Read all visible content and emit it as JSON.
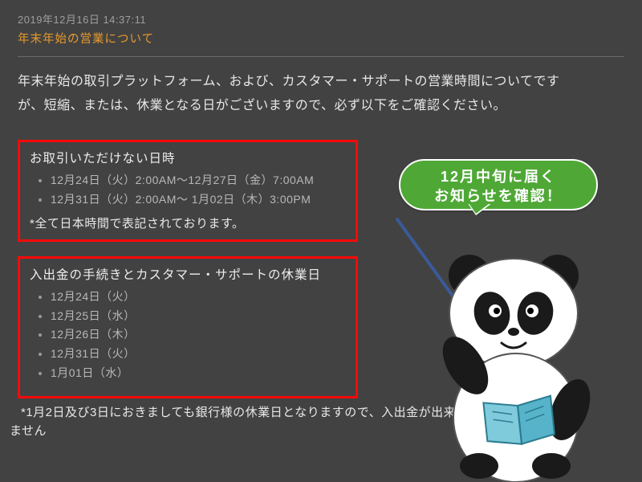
{
  "timestamp": "2019年12月16日 14:37:11",
  "title": "年末年始の営業について",
  "intro": "年末年始の取引プラットフォーム、および、カスタマー・サポートの営業時間についてですが、短縮、または、休業となる日がございますので、必ず以下をご確認ください。",
  "box1": {
    "heading": "お取引いただけない日時",
    "items": [
      "12月24日（火）2:00AM〜12月27日（金）7:00AM",
      "12月31日（火）2:00AM〜  1月02日（木）3:00PM"
    ],
    "note": "*全て日本時間で表記されております。"
  },
  "box2": {
    "heading": "入出金の手続きとカスタマー・サポートの休業日",
    "items": [
      "12月24日（火）",
      "12月25日（水）",
      "12月26日（木）",
      "12月31日（火）",
      "  1月01日（水）"
    ]
  },
  "after_note1": "*1月2日及び3日におきましても銀行様の休業日となりますので、入出金が出来",
  "after_note2": "ません",
  "bubble_line1": "12月中旬に届く",
  "bubble_line2": "お知らせを確認！"
}
